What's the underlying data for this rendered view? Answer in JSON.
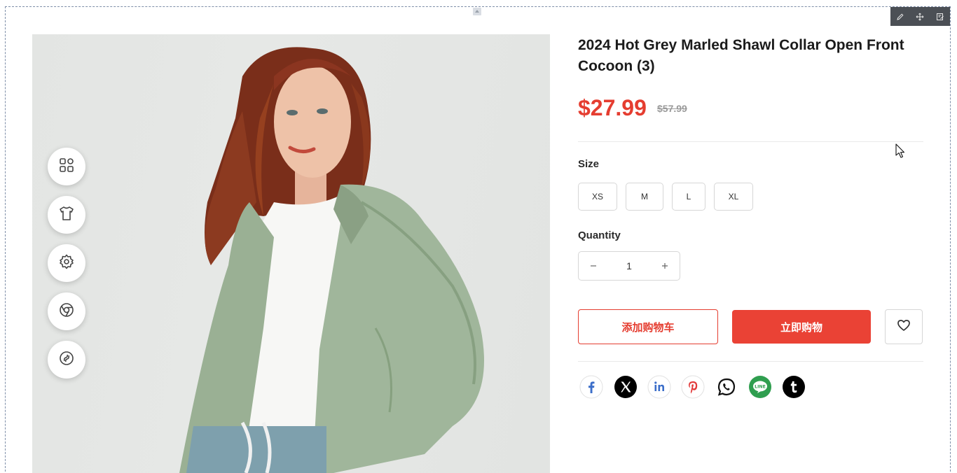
{
  "product": {
    "title": "2024 Hot Grey Marled Shawl Collar Open Front Cocoon (3)",
    "price": "$27.99",
    "compare_price": "$57.99",
    "size_label": "Size",
    "sizes": [
      "XS",
      "M",
      "L",
      "XL"
    ],
    "quantity_label": "Quantity",
    "quantity": "1",
    "add_to_cart_label": "添加购物车",
    "buy_now_label": "立即购物"
  },
  "colors": {
    "accent": "#e53d30",
    "buy_button": "#ea4235",
    "toolbar": "#4b4f55"
  },
  "editor_toolbar": {
    "icons": [
      "pencil-icon",
      "move-icon",
      "edit-note-icon"
    ]
  },
  "floating_tools": {
    "icons": [
      "apps-grid-icon",
      "tshirt-icon",
      "gear-icon",
      "chrome-icon",
      "link-icon"
    ]
  },
  "share": {
    "icons": [
      "facebook-icon",
      "x-twitter-icon",
      "linkedin-icon",
      "pinterest-icon",
      "whatsapp-icon",
      "line-icon",
      "tumblr-icon"
    ],
    "line_text": "LINE"
  }
}
